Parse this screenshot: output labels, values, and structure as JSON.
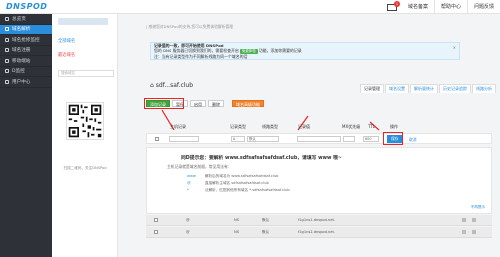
{
  "topbar": {
    "logo": "DNSPOD",
    "mail_count": "1",
    "links": [
      "域名备案",
      "帮助中心",
      "问题反馈"
    ]
  },
  "sidebar": {
    "items": [
      {
        "label": "总览页",
        "active": false
      },
      {
        "label": "域名解析",
        "active": true
      },
      {
        "label": "域名抢修监控",
        "active": false
      },
      {
        "label": "域名注册",
        "active": false
      },
      {
        "label": "移动端站",
        "active": false
      },
      {
        "label": "D监控",
        "active": false
      },
      {
        "label": "用户中心",
        "active": false
      }
    ]
  },
  "domain_list": {
    "all_domains": "全部域名",
    "recent_domains": "最近域名",
    "search_placeholder": "搜索域名",
    "qr_caption": "扫描二维码，关注DNSPod"
  },
  "main": {
    "breadcrumb": "|  感谢您对DNSPod的支持,您可以免费体验解析管理",
    "notice": {
      "line1": "记录值的一致，即可开始使用 DNSPod",
      "line2": "您的 DNS 服务器已切换到我们的，需要检查开启",
      "badge": "免费体验",
      "line2b": "功能，添加你需要的记录",
      "line3": "注：当有记录类型作为不同解析线路为同一个域名的话",
      "close": "×"
    },
    "domain_name": "sdf...saf.club",
    "tabs": [
      "记录管理",
      "域名设置",
      "解析量统计",
      "历史记录追踪",
      "线路分析"
    ],
    "toolbar": {
      "add": "添加记录",
      "pause": "暂停",
      "enable": "启用",
      "delete": "删除",
      "more": "域名高级功能"
    },
    "table_headers": [
      "主机记录",
      "记录类型",
      "线路类型",
      "记录值",
      "MX优先级",
      "TTL",
      "操作"
    ],
    "edit_row": {
      "type": "A",
      "line": "默认",
      "ttl": "600",
      "save": "保存",
      "cancel": "取消"
    },
    "tip": {
      "title": "同D提示您：要解析 www.sdfsafsafsafdsaf.club，请填写 www 哦~",
      "subtitle": "主机记录就是域名前缀，常见用法有：",
      "lines": [
        {
          "key": "www",
          "text": "解析后的域名为 www.sdfsafsafsafdsaf.club"
        },
        {
          "key": "@",
          "text": "直接解析主域名 sdfsafsafsafdsaf.club"
        },
        {
          "key": "*",
          "text": "泛解析，匹配其他所有域名 *.sdfsafsafsafdsaf.club"
        }
      ],
      "collapse": "不再提示"
    },
    "records": [
      {
        "host": "@",
        "type": "NS",
        "line": "默认",
        "value": "f1g1ns1.dnspod.net."
      },
      {
        "host": "@",
        "type": "NS",
        "line": "默认",
        "value": "f1g1ns2.dnspod.net."
      }
    ]
  },
  "colors": {
    "accent": "#2b8ddc",
    "sidebar_bg": "#2e3238",
    "add_button": "#41a63a",
    "highlight": "#e22222"
  }
}
